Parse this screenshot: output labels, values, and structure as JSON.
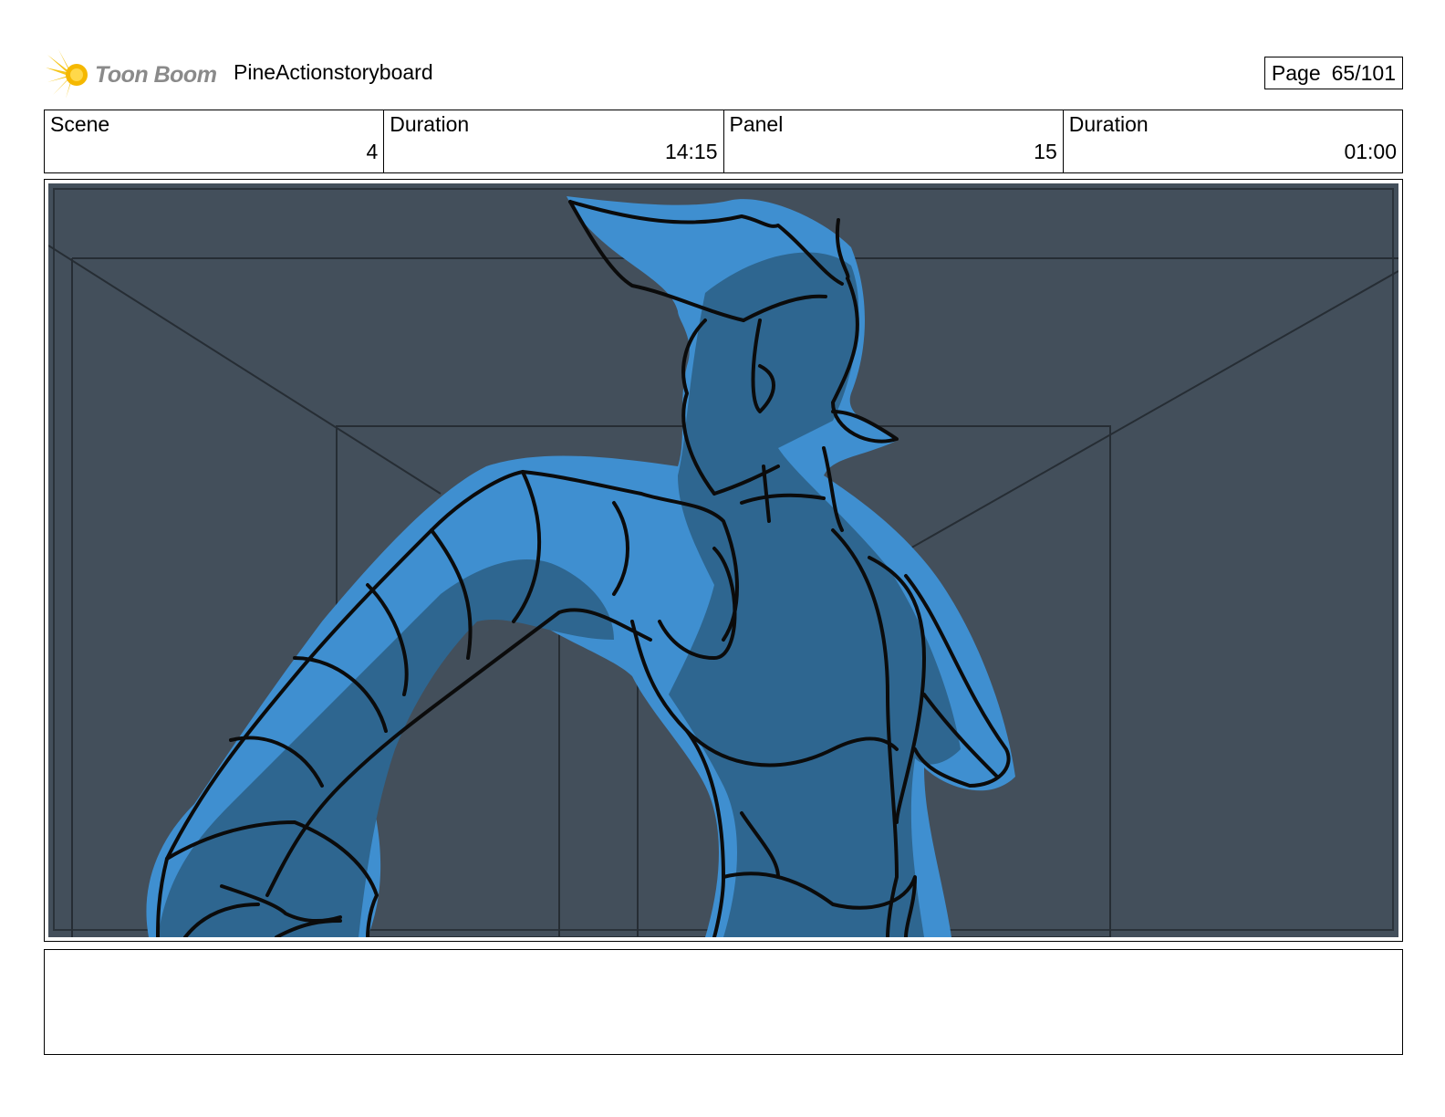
{
  "header": {
    "logo_text": "Toon Boom",
    "doc_title": "PineActionstoryboard",
    "page_label": "Page",
    "page_number": "65/101"
  },
  "info": {
    "scene_label": "Scene",
    "scene_value": "4",
    "scene_duration_label": "Duration",
    "scene_duration_value": "14:15",
    "panel_label": "Panel",
    "panel_value": "15",
    "panel_duration_label": "Duration",
    "panel_duration_value": "01:00"
  },
  "colors": {
    "logo_yellow": "#f5c518",
    "background_slate": "#434f5b",
    "character_blue": "#3f8fd0",
    "character_shade": "#2e6690"
  },
  "caption": ""
}
